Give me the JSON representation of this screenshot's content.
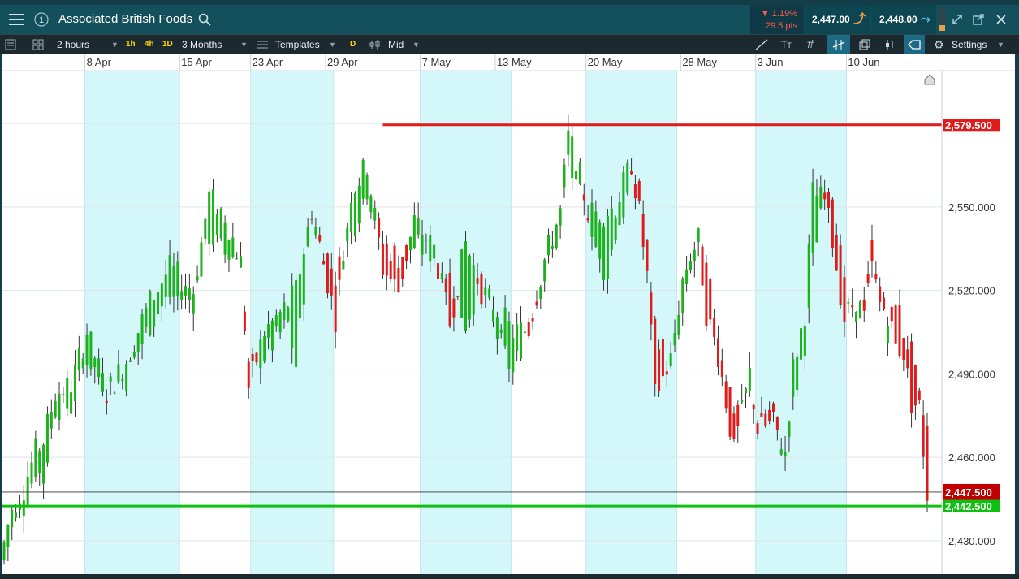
{
  "header": {
    "title": "Associated British Foods",
    "change_pct": "▼ 1.19%",
    "change_pts": "29.5 pts",
    "sell_price": "2,447.00",
    "buy_price": "2,448.00",
    "badge": "1"
  },
  "toolbar": {
    "interval": "2 hours",
    "presets": [
      "1h",
      "4h",
      "1D"
    ],
    "range": "3 Months",
    "templates": "Templates",
    "d_label": "D",
    "price_type": "Mid",
    "settings": "Settings"
  },
  "colors": {
    "up": "#1bb21b",
    "down": "#e01b1b",
    "resistance": "#e01b1b",
    "support": "#10c010",
    "shade": "#d4f7fa",
    "current_tag": "#c00000"
  },
  "chart_data": {
    "type": "candlestick",
    "title": "",
    "ylim": [
      2418,
      2599
    ],
    "yticks": [
      "2,430.000",
      "2,460.000",
      "2,490.000",
      "2,520.000",
      "2,550.000",
      "2,580.000"
    ],
    "ytick_values": [
      2430,
      2460,
      2490,
      2520,
      2550,
      2580
    ],
    "x_labels": [
      "8 Apr",
      "15 Apr",
      "23 Apr",
      "29 Apr",
      "7 May",
      "13 May",
      "20 May",
      "28 May",
      "3 Jun",
      "10 Jun"
    ],
    "resistance": {
      "value": 2579.5,
      "label": "2,579.500"
    },
    "support": {
      "value": 2442.5,
      "label": "2,442.500"
    },
    "current": {
      "value": 2447.5,
      "label": "2,447.500"
    },
    "anchors": [
      [
        0,
        2423,
        2429
      ],
      [
        2,
        2434,
        2442
      ],
      [
        5,
        2442,
        2449
      ],
      [
        8,
        2456,
        2462
      ],
      [
        10,
        2452,
        2466
      ],
      [
        13,
        2478,
        2483
      ],
      [
        17,
        2478,
        2486
      ],
      [
        21,
        2496,
        2505
      ],
      [
        26,
        2485,
        2483
      ],
      [
        31,
        2488,
        2495
      ],
      [
        37,
        2508,
        2516
      ],
      [
        42,
        2518,
        2528
      ],
      [
        48,
        2516,
        2520
      ],
      [
        52,
        2540,
        2554
      ],
      [
        56,
        2533,
        2547
      ],
      [
        60,
        2532,
        2530
      ],
      [
        62,
        2492,
        2485
      ],
      [
        66,
        2497,
        2505
      ],
      [
        72,
        2508,
        2515
      ],
      [
        74,
        2493,
        2520
      ],
      [
        78,
        2546,
        2549
      ],
      [
        84,
        2525,
        2510
      ],
      [
        88,
        2540,
        2555
      ],
      [
        92,
        2557,
        2565
      ],
      [
        96,
        2537,
        2528
      ],
      [
        100,
        2532,
        2520
      ],
      [
        104,
        2536,
        2545
      ],
      [
        109,
        2533,
        2535
      ],
      [
        113,
        2525,
        2508
      ],
      [
        117,
        2508,
        2537
      ],
      [
        121,
        2524,
        2520
      ],
      [
        124,
        2507,
        2515
      ],
      [
        129,
        2490,
        2505
      ],
      [
        133,
        2510,
        2506
      ],
      [
        137,
        2525,
        2531
      ],
      [
        141,
        2542,
        2548
      ],
      [
        143,
        2568,
        2575
      ],
      [
        145,
        2555,
        2568
      ],
      [
        148,
        2550,
        2548
      ],
      [
        152,
        2522,
        2548
      ],
      [
        155,
        2540,
        2550
      ],
      [
        159,
        2558,
        2566
      ],
      [
        161,
        2560,
        2548
      ],
      [
        163,
        2535,
        2525
      ],
      [
        165,
        2508,
        2482
      ],
      [
        169,
        2490,
        2495
      ],
      [
        172,
        2510,
        2524
      ],
      [
        174,
        2526,
        2533
      ],
      [
        176,
        2535,
        2538
      ],
      [
        178,
        2527,
        2512
      ],
      [
        181,
        2505,
        2497
      ],
      [
        183,
        2490,
        2480
      ],
      [
        185,
        2478,
        2462
      ],
      [
        189,
        2482,
        2490
      ],
      [
        191,
        2475,
        2470
      ],
      [
        195,
        2478,
        2472
      ],
      [
        198,
        2458,
        2462
      ],
      [
        200,
        2478,
        2492
      ],
      [
        203,
        2498,
        2512
      ],
      [
        205,
        2530,
        2555
      ],
      [
        208,
        2560,
        2552
      ],
      [
        210,
        2557,
        2538
      ],
      [
        213,
        2520,
        2510
      ],
      [
        216,
        2505,
        2517
      ],
      [
        218,
        2520,
        2510
      ],
      [
        220,
        2535,
        2528
      ],
      [
        222,
        2525,
        2515
      ],
      [
        224,
        2502,
        2512
      ],
      [
        226,
        2518,
        2500
      ],
      [
        228,
        2505,
        2498
      ],
      [
        230,
        2497,
        2480
      ],
      [
        232,
        2480,
        2478
      ],
      [
        234,
        2470,
        2447
      ]
    ],
    "shaded_bands": [
      [
        21,
        45
      ],
      [
        63,
        84
      ],
      [
        106,
        129
      ],
      [
        148,
        171
      ],
      [
        191,
        214
      ]
    ],
    "x_label_index": [
      21,
      45,
      63,
      82,
      106,
      125,
      148,
      172,
      191,
      214
    ]
  }
}
